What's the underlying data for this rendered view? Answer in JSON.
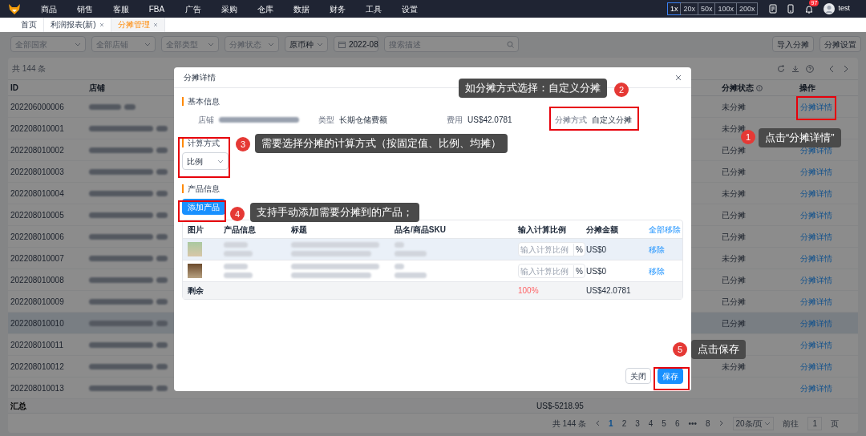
{
  "nav": {
    "menu": [
      "商品",
      "销售",
      "客服",
      "FBA",
      "广告",
      "采购",
      "仓库",
      "数据",
      "财务",
      "工具",
      "设置"
    ],
    "zoom_levels": [
      {
        "label": "1x",
        "selected": true
      },
      {
        "label": "20x",
        "selected": false
      },
      {
        "label": "50x",
        "selected": false
      },
      {
        "label": "100x",
        "selected": false
      },
      {
        "label": "200x",
        "selected": false
      }
    ],
    "notification_count": "97",
    "user": "test"
  },
  "tabs": [
    {
      "label": "首页",
      "closable": false,
      "selected": false
    },
    {
      "label": "利润报表(新)",
      "closable": true,
      "selected": false
    },
    {
      "label": "分摊管理",
      "closable": true,
      "selected": true
    }
  ],
  "filters": [
    {
      "kind": "select",
      "placeholder": "全部国家"
    },
    {
      "kind": "select",
      "placeholder": "全部店铺"
    },
    {
      "kind": "select",
      "placeholder": "全部类型"
    },
    {
      "kind": "select",
      "placeholder": "分摊状态"
    },
    {
      "kind": "select",
      "value": "原币种"
    },
    {
      "kind": "date",
      "value": "2022-08"
    },
    {
      "kind": "search",
      "placeholder": "搜索描述"
    }
  ],
  "actions": [
    "导入分摊",
    "分摊设置"
  ],
  "table": {
    "total": "共 144 条",
    "columns": [
      "ID",
      "店铺",
      "分摊状态",
      "操作"
    ],
    "rows": [
      {
        "id": "202206000006",
        "status": "未分摊",
        "action": "分摊详情",
        "highlighted": false
      },
      {
        "id": "202208010001",
        "status": "未分摊",
        "highlighted": false
      },
      {
        "id": "202208010002",
        "status": "已分摊",
        "action": "分摊详情",
        "highlighted": false
      },
      {
        "id": "202208010003",
        "status": "已分摊",
        "action": "分摊详情",
        "highlighted": false
      },
      {
        "id": "202208010004",
        "status": "未分摊",
        "action": "分摊详情",
        "highlighted": false
      },
      {
        "id": "202208010005",
        "status": "已分摊",
        "action": "分摊详情",
        "highlighted": false
      },
      {
        "id": "202208010006",
        "status": "已分摊",
        "action": "分摊详情",
        "highlighted": false
      },
      {
        "id": "202208010007",
        "status": "未分摊",
        "action": "分摊详情",
        "highlighted": false
      },
      {
        "id": "202208010008",
        "status": "已分摊",
        "action": "分摊详情",
        "highlighted": false
      },
      {
        "id": "202208010009",
        "status": "已分摊",
        "action": "分摊详情",
        "highlighted": false
      },
      {
        "id": "202208010010",
        "status": "已分摊",
        "action": "分摊详情",
        "highlighted": true
      },
      {
        "id": "202208010011",
        "action": "分摊详情",
        "highlighted": false
      },
      {
        "id": "202208010012",
        "status": "未分摊",
        "action": "分摊详情",
        "highlighted": false
      },
      {
        "id": "202208010013",
        "action": "分摊详情",
        "highlighted": false
      }
    ],
    "summary": {
      "label": "汇总",
      "amount": "US$-5218.95"
    }
  },
  "pagination": {
    "total": "共 144 条",
    "pages": [
      {
        "label": "1",
        "selected": true
      },
      {
        "label": "2",
        "selected": false
      },
      {
        "label": "3",
        "selected": false
      },
      {
        "label": "4",
        "selected": false
      },
      {
        "label": "5",
        "selected": false
      },
      {
        "label": "6",
        "selected": false
      },
      {
        "label": "•••",
        "selected": false
      },
      {
        "label": "8",
        "selected": false
      }
    ],
    "page_size": "20条/页",
    "goto_label": "前往",
    "goto_value": "1",
    "goto_suffix": "页"
  },
  "dialog": {
    "title": "分摊详情",
    "basic_info": {
      "heading": "基本信息",
      "fields": [
        {
          "label": "店铺",
          "kind": "blurred"
        },
        {
          "label": "类型",
          "kind": "text",
          "value": "长期仓储费额"
        },
        {
          "label": "费用",
          "kind": "text",
          "value": "US$42.0781"
        },
        {
          "label": "分摊方式",
          "kind": "text",
          "value": "自定义分摊"
        }
      ]
    },
    "calculation": {
      "heading": "计算方式",
      "value": "比例"
    },
    "products": {
      "heading": "产品信息",
      "add_button": "添加产品",
      "columns": [
        "图片",
        "产品信息",
        "标题",
        "品名/商品SKU",
        "输入计算比例",
        "分摊金额"
      ],
      "remove_all": "全部移除",
      "rows": [
        {
          "highlighted": true,
          "ratio_placeholder": "输入计算比例",
          "unit": "%",
          "amount": "US$0",
          "remove": "移除"
        },
        {
          "highlighted": false,
          "ratio_placeholder": "输入计算比例",
          "unit": "%",
          "amount": "US$0",
          "remove": "移除"
        }
      ],
      "remaining": {
        "label": "剩余",
        "ratio": "100%",
        "amount": "US$42.0781"
      }
    },
    "buttons": [
      {
        "label": "关闭",
        "kind": "secondary"
      },
      {
        "label": "保存",
        "kind": "primary"
      }
    ]
  },
  "callouts": [
    {
      "number": "1",
      "text": "点击“分摊详情”"
    },
    {
      "number": "2",
      "text": "如分摊方式选择：自定义分摊"
    },
    {
      "number": "3",
      "text": "需要选择分摊的计算方式（按固定值、比例、均摊）"
    },
    {
      "number": "4",
      "text": "支持手动添加需要分摊到的产品；"
    },
    {
      "number": "5",
      "text": "点击保存"
    }
  ]
}
